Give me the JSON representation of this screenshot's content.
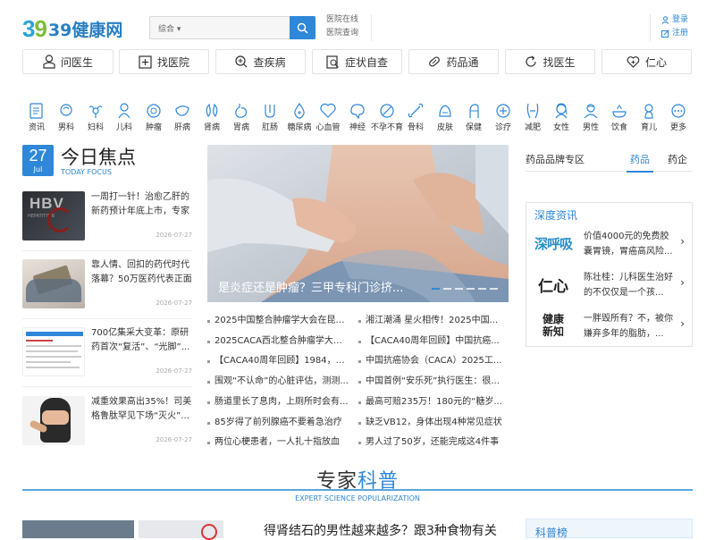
{
  "header": {
    "logo_number": "39",
    "logo_text": "39健康网",
    "search_category": "综合",
    "search_placeholder": "",
    "links": [
      "医院在线",
      "医院查询"
    ],
    "login": "登录",
    "register": "注册"
  },
  "nav": [
    {
      "label": "问医生",
      "icon": "user-icon"
    },
    {
      "label": "找医院",
      "icon": "hospital-icon"
    },
    {
      "label": "查疾病",
      "icon": "search-plus-icon"
    },
    {
      "label": "症状自查",
      "icon": "checklist-icon"
    },
    {
      "label": "药品通",
      "icon": "pill-icon"
    },
    {
      "label": "找医生",
      "icon": "refresh-icon"
    },
    {
      "label": "仁心",
      "icon": "heart-plus-icon"
    }
  ],
  "categories": [
    "资讯",
    "男科",
    "妇科",
    "儿科",
    "肿瘤",
    "肝病",
    "肾病",
    "胃病",
    "肛肠",
    "糖尿病",
    "心血管",
    "神经",
    "不孕不育",
    "骨科",
    "皮肤",
    "保健",
    "诊疗",
    "减肥",
    "女性",
    "男性",
    "饮食",
    "育儿",
    "更多"
  ],
  "focus": {
    "day": "27",
    "month": "Jul",
    "title": "今日焦点",
    "subtitle": "TODAY FOCUS",
    "items": [
      {
        "title": "一周打一针！治愈乙肝的新药预计年底上市，专家说...",
        "date": "2026-07-27",
        "thumb_text": "HBV"
      },
      {
        "title": "靠人情、回扣的药代时代落幕？50万医药代表正面临...",
        "date": "2026-07-27"
      },
      {
        "title": "700亿集采大变革：原研药首次“复活”、“光脚”...",
        "date": "2026-07-27"
      },
      {
        "title": "减重效果高出35%！司美格鲁肽罕见下场“灭火”...",
        "date": "2026-07-27"
      }
    ]
  },
  "hero": {
    "caption": "是炎症还是肿瘤？三甲专科门诊挤...",
    "dots": 6,
    "active_dot": 0
  },
  "news_left": [
    "2025中国整合肿瘤学大会在昆明...",
    "2025CACA西北整合肿瘤学大会...",
    "【CACA40周年回顾】1984，中...",
    "围观“不认命”的心脏评估，测测...",
    "肠道里长了息肉，上厕所时会有...",
    "85岁得了前列腺癌不要着急治疗",
    "两位心梗患者，一人扎十指放血"
  ],
  "news_right": [
    "湘江潮涌 星火相传！2025中国...",
    "【CACA40周年回顾】中国抗癌...",
    "中国抗癌协会（CACA）2025工...",
    "中国首例“安乐死”执行医生：很...",
    "最高可赔235万！180元的“糖岁...",
    "缺乏VB12，身体出现4种常见症状",
    "男人过了50岁，还能完成这4件事"
  ],
  "brand": {
    "title": "药品品牌专区",
    "tab_active": "药品",
    "tab_other": "药企"
  },
  "deep": {
    "title": "深度资讯",
    "items": [
      {
        "logo": "深呼吸",
        "text": "价值4000元的免费胶囊胃镜，胃癌高风险..."
      },
      {
        "logo": "仁心",
        "text": "陈壮桂：儿科医生治好的不仅仅是一个孩..."
      },
      {
        "logo": "健康新知",
        "text": "一胖毁所有？不，被你嫌弃多年的脂肪，..."
      }
    ]
  },
  "expert": {
    "title_a": "专家",
    "title_b": "科普",
    "subtitle": "EXPERT SCIENCE POPULARIZATION"
  },
  "bottom": {
    "title": "得肾结石的男性越来越多？跟3种食物有关",
    "box_label": "科普榜"
  },
  "colors": {
    "accent": "#2e87d9",
    "logo_green": "#7dbe3a"
  }
}
